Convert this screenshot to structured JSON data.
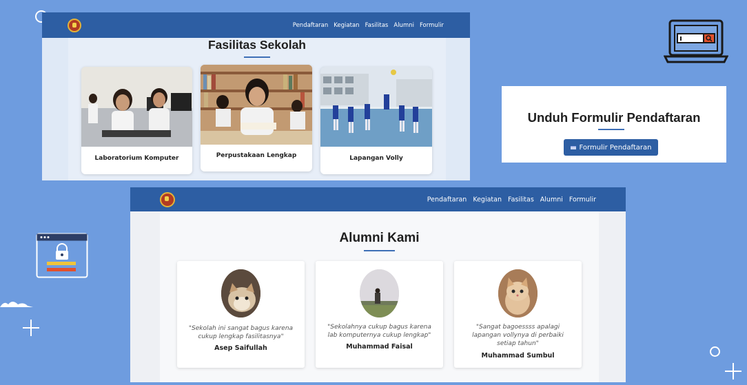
{
  "nav": {
    "items": [
      "Pendaftaran",
      "Kegiatan",
      "Fasilitas",
      "Alumni",
      "Formulir"
    ]
  },
  "fasilitas": {
    "title": "Fasilitas Sekolah",
    "cards": [
      {
        "label": "Laboratorium Komputer"
      },
      {
        "label": "Perpustakaan Lengkap"
      },
      {
        "label": "Lapangan Volly"
      }
    ]
  },
  "formulir": {
    "title": "Unduh Formulir Pendaftaran",
    "button_label": "Formulir Pendaftaran",
    "button_icon": "document-icon"
  },
  "alumni": {
    "title": "Alumni Kami",
    "items": [
      {
        "quote": "\"Sekolah ini sangat bagus karena cukup lengkap fasilitasnya\"",
        "name": "Asep Saifullah"
      },
      {
        "quote": "\"Sekolahnya cukup bagus karena lab komputernya cukup lengkap\"",
        "name": "Muhammad Faisal"
      },
      {
        "quote": "\"Sangat bagoessss apalagi lapangan vollynya di perbaiki setiap tahun\"",
        "name": "Muhammad Sumbul"
      }
    ]
  },
  "colors": {
    "background": "#6e9cdf",
    "nav": "#2d5ea3",
    "accent": "#3d6fb6"
  }
}
